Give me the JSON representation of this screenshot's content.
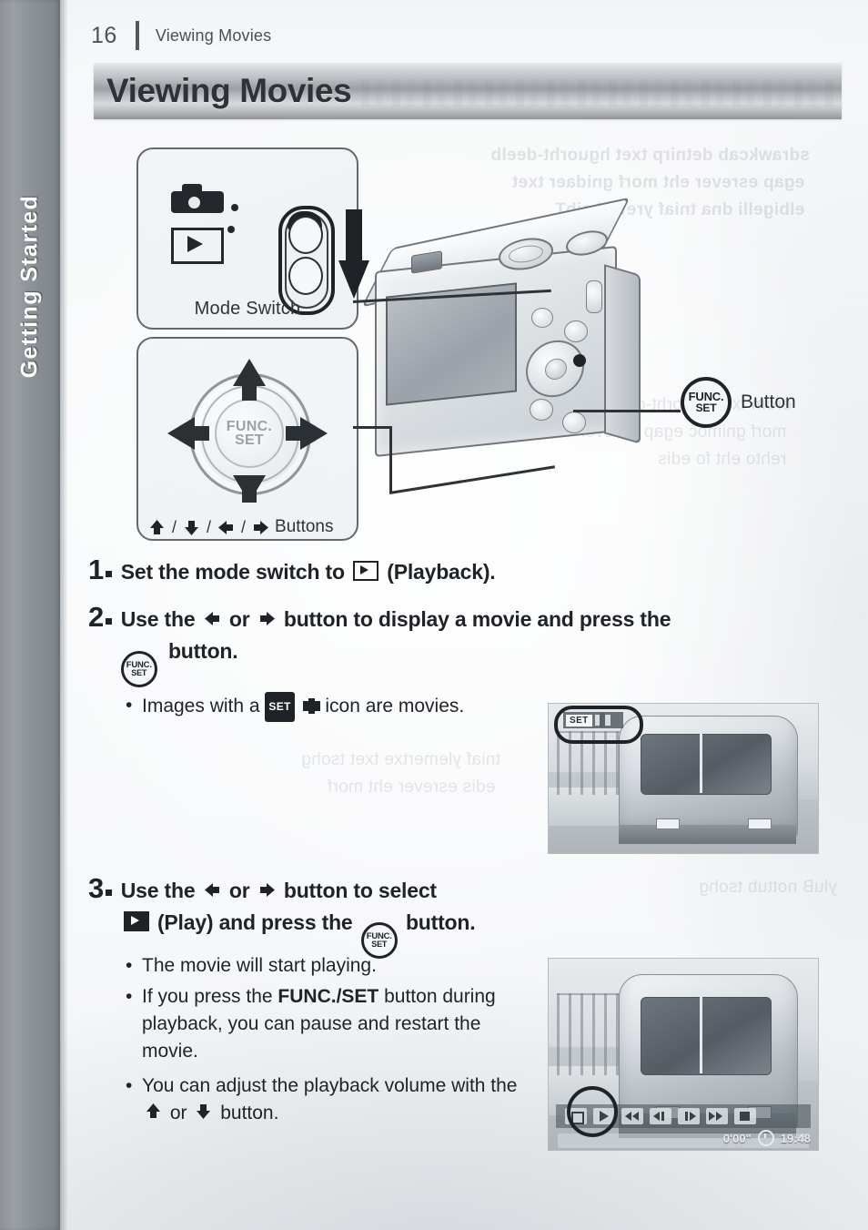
{
  "page": {
    "number": "16",
    "running_head": "Viewing Movies",
    "side_tab": "Getting Started"
  },
  "banner": {
    "title": "Viewing Movies"
  },
  "callouts": {
    "mode_switch": {
      "label": "Mode Switch",
      "camera_icon": "camera-icon",
      "playback_icon": "playback-icon",
      "switch_icon": "mode-switch-slider",
      "arrow_icon": "down-arrow-icon"
    },
    "buttons_pad": {
      "label": "Buttons",
      "up": "up-arrow-icon",
      "down": "down-arrow-icon",
      "left": "left-arrow-icon",
      "right": "right-arrow-icon",
      "separator": "/",
      "center_line1": "FUNC.",
      "center_line2": "SET"
    },
    "func_set_button": {
      "icon_line1": "FUNC.",
      "icon_line2": "SET",
      "label": "Button"
    }
  },
  "steps": [
    {
      "number": "1",
      "text_before": "Set the mode switch to",
      "icon": "playback-icon",
      "text_after": "(Playback)."
    },
    {
      "number": "2",
      "line1_a": "Use the",
      "line1_icon_left": "left-arrow-icon",
      "line1_b": "or",
      "line1_icon_right": "right-arrow-icon",
      "line1_c": "button to display a movie and press the",
      "line2_icon": "func-set-icon",
      "line2_text": "button.",
      "bullets": [
        {
          "text_before": "Images with a",
          "icon_set": "SET",
          "icon_movie": "movie-icon",
          "text_after": "icon are movies."
        }
      ]
    },
    {
      "number": "3",
      "line1_a": "Use the",
      "line1_icon_left": "left-arrow-icon",
      "line1_b": "or",
      "line1_icon_right": "right-arrow-icon",
      "line1_c": "button to select",
      "line2_icon": "play-icon",
      "line2_a": "(Play) and press the",
      "line2_icon2": "func-set-icon",
      "line2_b": "button.",
      "bullets": [
        {
          "text": "The movie will start playing."
        },
        {
          "text_before": "If you press the",
          "bold": "FUNC./SET",
          "text_after": "button during playback, you can pause and restart the movie."
        },
        {
          "text_before": "You can adjust the playback volume with the",
          "icon_up": "up-arrow-icon",
          "mid": "or",
          "icon_down": "down-arrow-icon",
          "text_after": "button."
        }
      ]
    }
  ],
  "screenshots": [
    {
      "name": "movie-thumbnail-with-set-badge",
      "badge_text": "SET",
      "badge_icon": "movie-icon",
      "highlight": "oval-highlight"
    },
    {
      "name": "movie-playback-control-panel",
      "controls": [
        "exit-icon",
        "play-icon",
        "rewind-icon",
        "previous-frame-icon",
        "next-frame-icon",
        "fast-forward-icon",
        "stop-icon"
      ],
      "elapsed_time": "0'00\"",
      "clock_icon": "clock-icon",
      "timestamp": "19:48",
      "highlight": "circle-highlight"
    }
  ],
  "ghost_text": {
    "line1": "bleed-through from reverse page",
    "line2": "illegible show-through text"
  },
  "colors": {
    "ink": "#1f2327",
    "side_tab": "#8e9297",
    "banner_mid": "#9ba0a5"
  }
}
